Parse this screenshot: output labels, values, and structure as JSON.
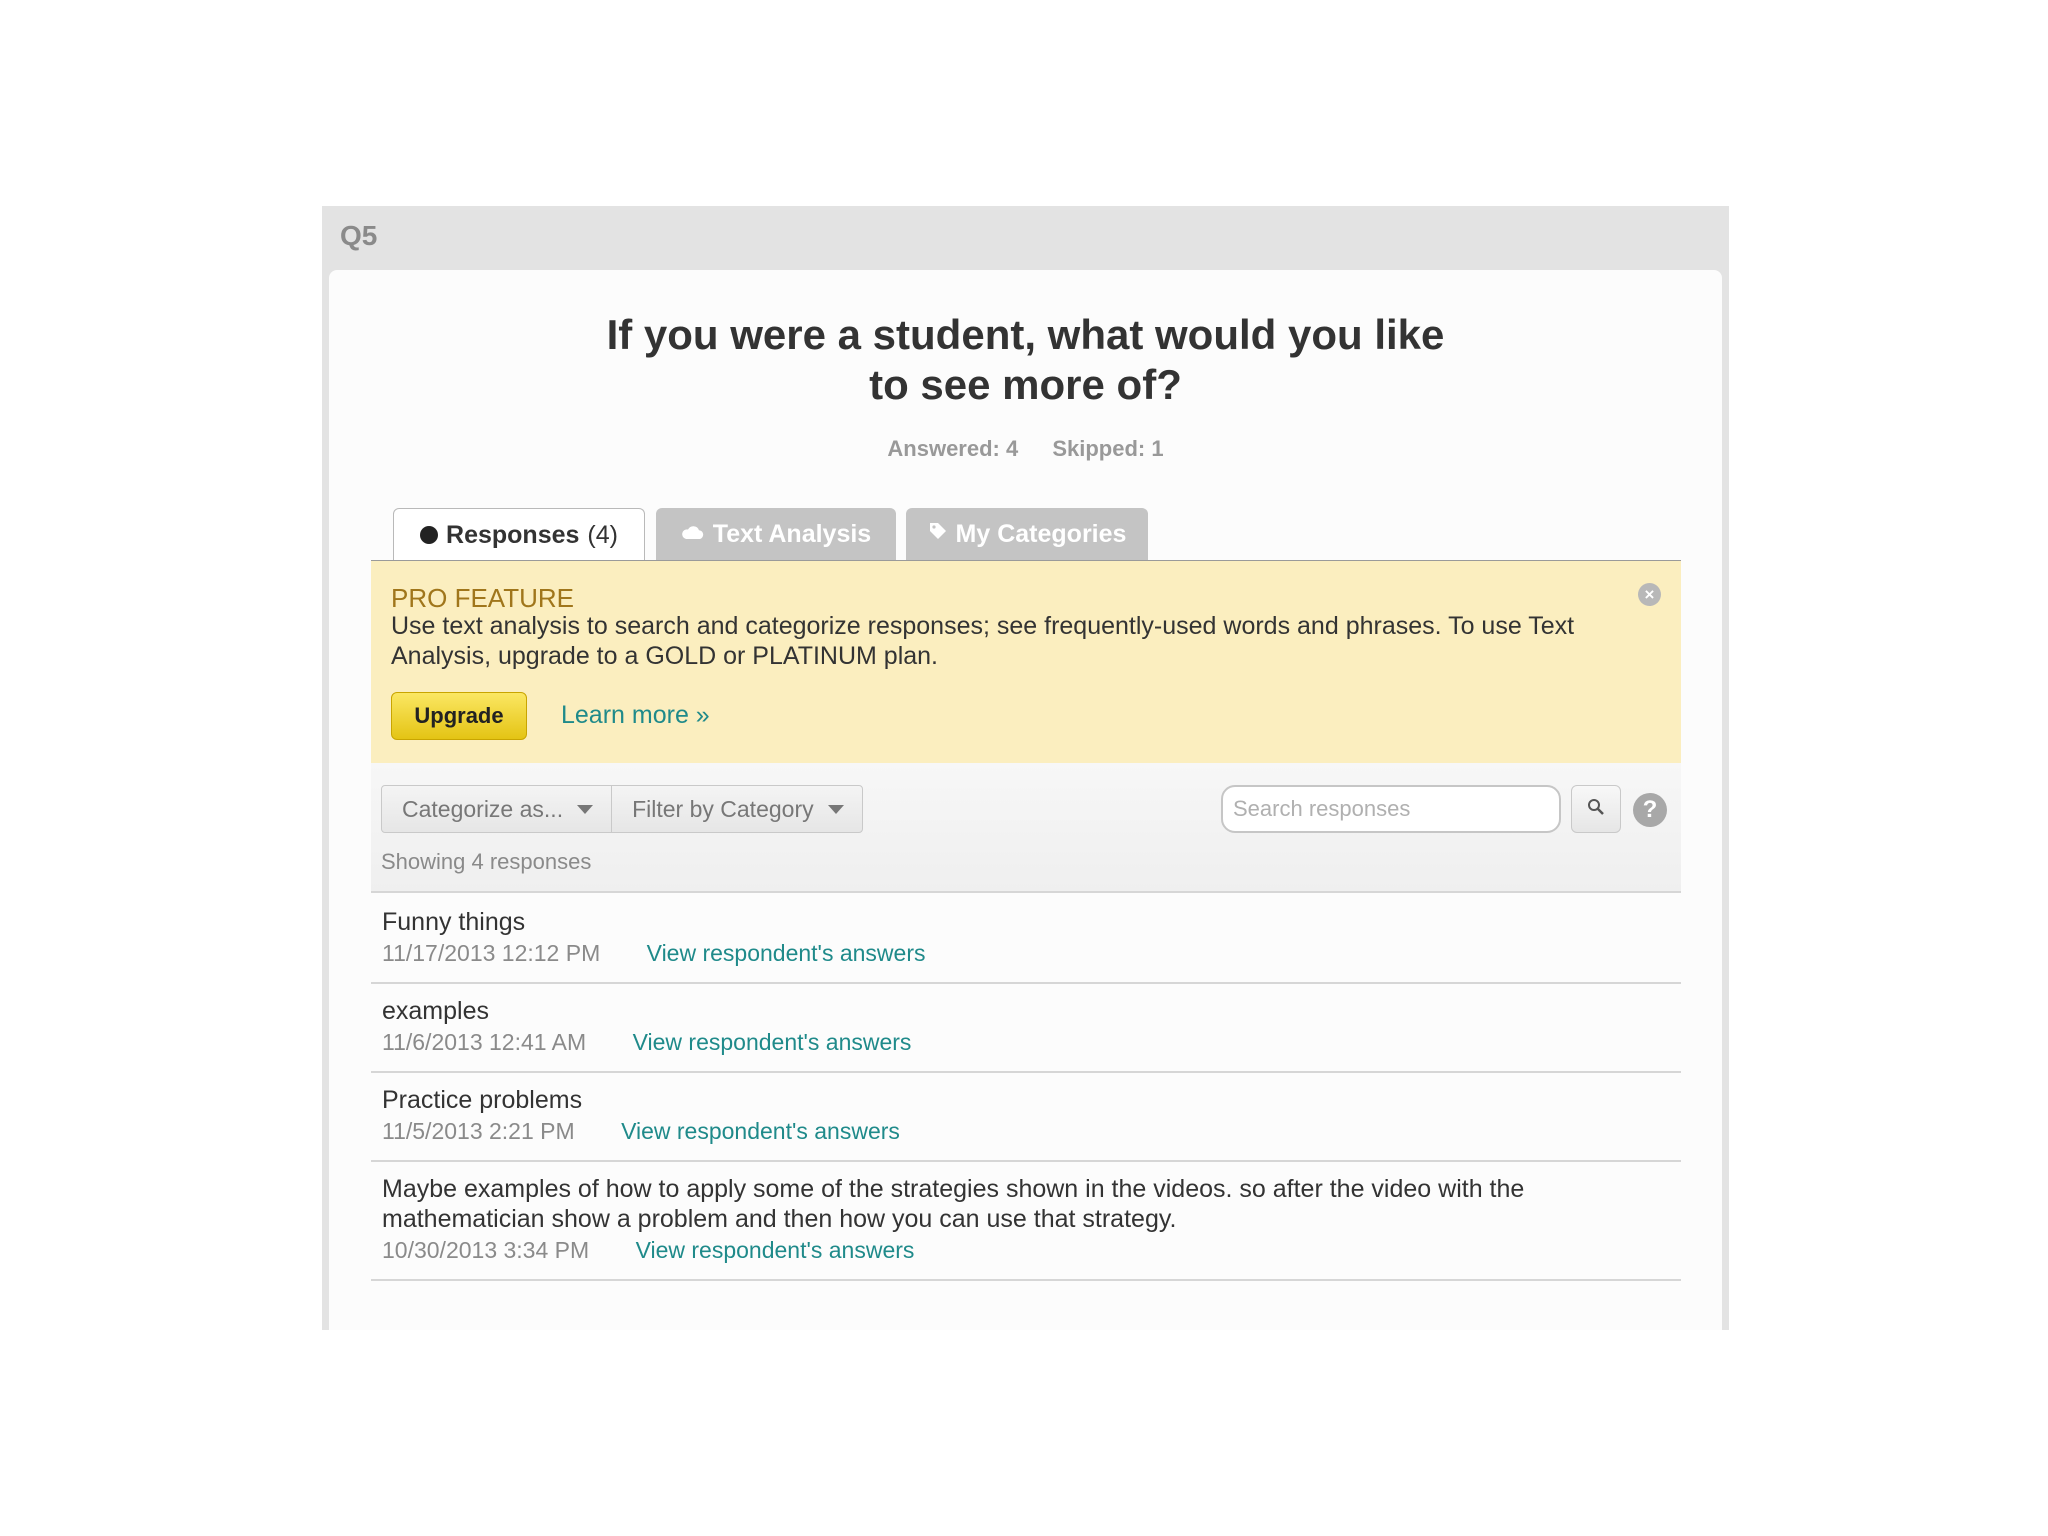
{
  "question": {
    "number": "Q5",
    "title_line1": "If you were a student, what would you like",
    "title_line2": "to see more of?",
    "answered": "Answered: 4",
    "skipped": "Skipped: 1"
  },
  "tabs": [
    {
      "label": "Responses",
      "count": "(4)",
      "icon": "bullet-icon",
      "active": true
    },
    {
      "label": "Text Analysis",
      "icon": "cloud-icon",
      "active": false
    },
    {
      "label": "My Categories",
      "icon": "tag-icon",
      "active": false
    }
  ],
  "promo": {
    "title": "PRO FEATURE",
    "text": "Use text analysis to search and categorize responses; see frequently-used words and phrases. To use Text Analysis, upgrade to a GOLD or PLATINUM plan.",
    "upgrade_label": "Upgrade",
    "learn_more_label": "Learn more »",
    "close_glyph": "×"
  },
  "toolbar": {
    "categorize_label": "Categorize as...",
    "filter_label": "Filter by Category",
    "search_placeholder": "Search responses",
    "help_glyph": "?",
    "showing": "Showing 4 responses"
  },
  "responses": [
    {
      "text": "Funny things",
      "date": "11/17/2013 12:12 PM",
      "link": "View respondent's answers"
    },
    {
      "text": "examples",
      "date": "11/6/2013 12:41 AM",
      "link": "View respondent's answers"
    },
    {
      "text": "Practice problems",
      "date": "11/5/2013 2:21 PM",
      "link": "View respondent's answers"
    },
    {
      "text": "Maybe examples of how to apply some of the strategies shown in the videos. so after the video with the mathematician show a problem and then how you can use that strategy.",
      "date": "10/30/2013 3:34 PM",
      "link": "View respondent's answers"
    }
  ],
  "colors": {
    "promo_bg": "#fbeebf",
    "promo_title": "#a0761b",
    "link": "#1f8a8a",
    "upgrade_button": "#f0d430",
    "inactive_tab": "#c4c4c4"
  }
}
